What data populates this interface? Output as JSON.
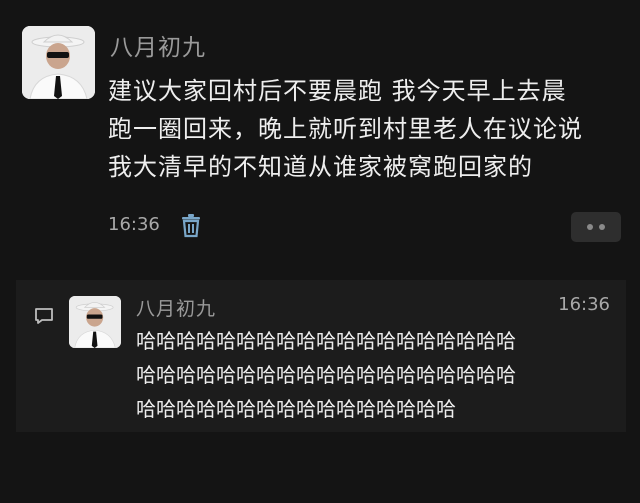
{
  "post": {
    "author": "八月初九",
    "text_lines": [
      "建议大家回村后不要晨跑 我今天早上去晨",
      "跑一圈回来，晚上就听到村里老人在议论说",
      "我大清早的不知道从谁家被窝跑回家的"
    ],
    "time": "16:36",
    "delete_icon": "trash-icon",
    "more_icon": "more-dots-icon"
  },
  "comments": [
    {
      "author": "八月初九",
      "time": "16:36",
      "text_lines": [
        "哈哈哈哈哈哈哈哈哈哈哈哈哈哈哈哈哈哈哈",
        "哈哈哈哈哈哈哈哈哈哈哈哈哈哈哈哈哈哈哈",
        "哈哈哈哈哈哈哈哈哈哈哈哈哈哈哈哈"
      ],
      "icon": "comment-icon"
    }
  ]
}
